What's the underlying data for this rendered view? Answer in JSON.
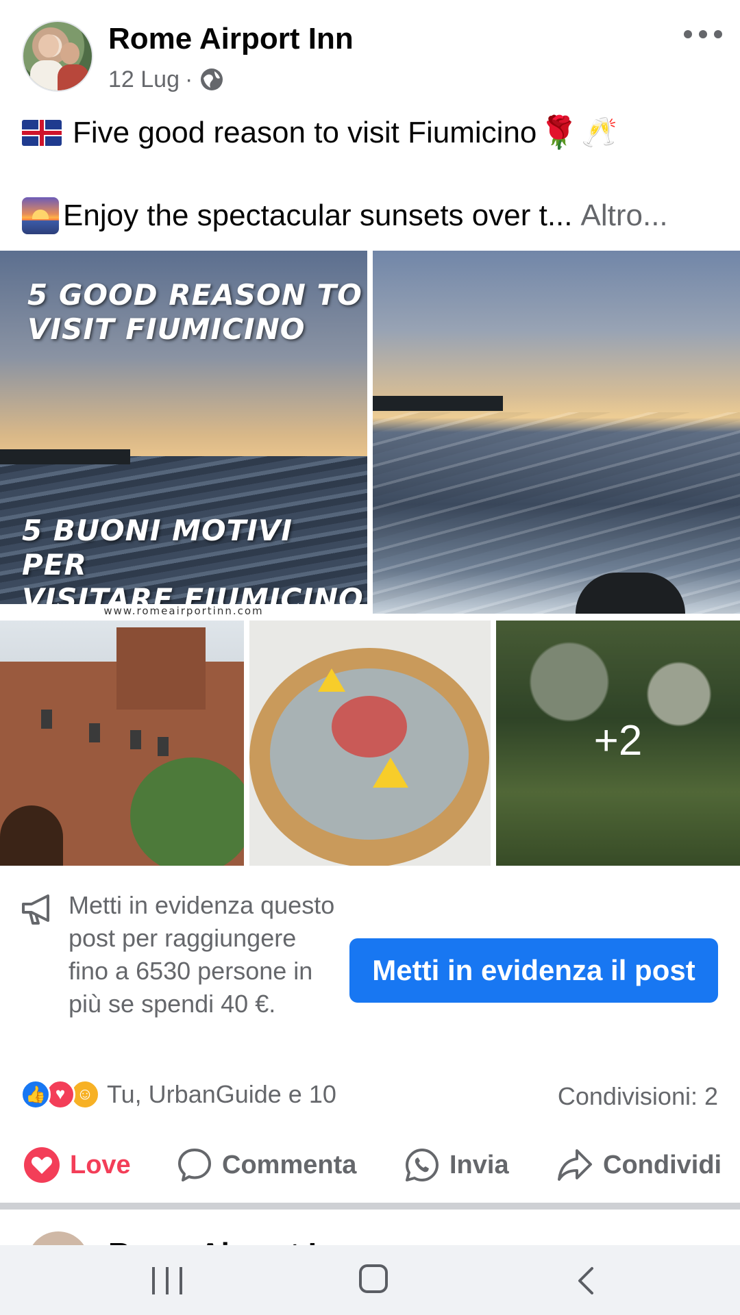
{
  "post": {
    "page_name": "Rome Airport Inn",
    "date": "12 Lug",
    "separator": "·",
    "line1": "Five good reason to visit Fiumicino",
    "line1_emoji_rose": "🌹",
    "line1_emoji_glasses": "🥂",
    "line2": "Enjoy the spectacular sunsets over t...",
    "more_label": "Altro..."
  },
  "photos": {
    "p1_caption_top_1": "5 GOOD REASON TO",
    "p1_caption_top_2": "VISIT FIUMICINO",
    "p1_caption_bottom_1": "5 BUONI MOTIVI PER",
    "p1_caption_bottom_2": "VISITARE FIUMICINO",
    "p1_url": "www.romeairportinn.com",
    "extra_count": "+2"
  },
  "boost": {
    "text": "Metti in evidenza questo post per raggiungere fino a 6530 persone in più se spendi 40 €.",
    "button_label": "Metti in evidenza il post"
  },
  "engagement": {
    "reactions_text": "Tu, UrbanGuide e 10",
    "shares_text": "Condivisioni: 2"
  },
  "actions": {
    "love": "Love",
    "comment": "Commenta",
    "send": "Invia",
    "share": "Condividi"
  },
  "next_post": {
    "page_name": "Rome Airport Inn"
  },
  "colors": {
    "brand_blue": "#1877f2",
    "love_red": "#f33e58",
    "secondary_text": "#65676b"
  }
}
